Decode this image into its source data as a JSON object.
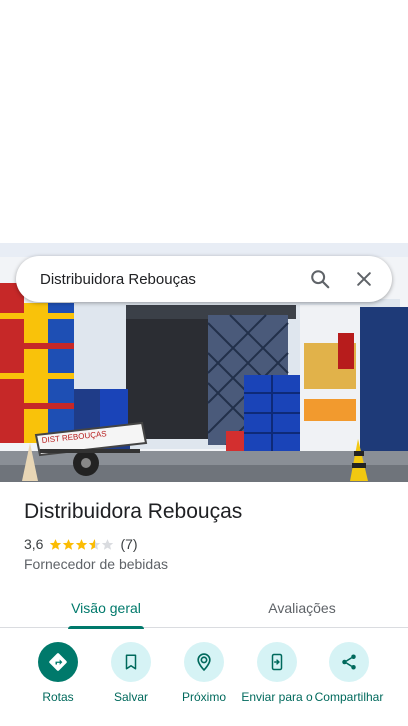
{
  "search": {
    "query": "Distribuidora Rebouças"
  },
  "place": {
    "name": "Distribuidora Rebouças",
    "rating": "3,6",
    "rating_value": 3.6,
    "review_count": "(7)",
    "category": "Fornecedor de bebidas",
    "photo_sign_text": "DIST REBOUÇAS"
  },
  "tabs": [
    {
      "label": "Visão geral",
      "active": true
    },
    {
      "label": "Avaliações",
      "active": false
    }
  ],
  "actions": [
    {
      "label": "Rotas",
      "icon": "directions-icon"
    },
    {
      "label": "Salvar",
      "icon": "bookmark-icon"
    },
    {
      "label": "Próximo",
      "icon": "nearby-icon"
    },
    {
      "label": "Enviar para o",
      "icon": "send-to-phone-icon"
    },
    {
      "label": "Compartilhar",
      "icon": "share-icon"
    }
  ],
  "colors": {
    "accent": "#00796b",
    "accent_light": "#d6f3f5",
    "star": "#fbbc04"
  }
}
